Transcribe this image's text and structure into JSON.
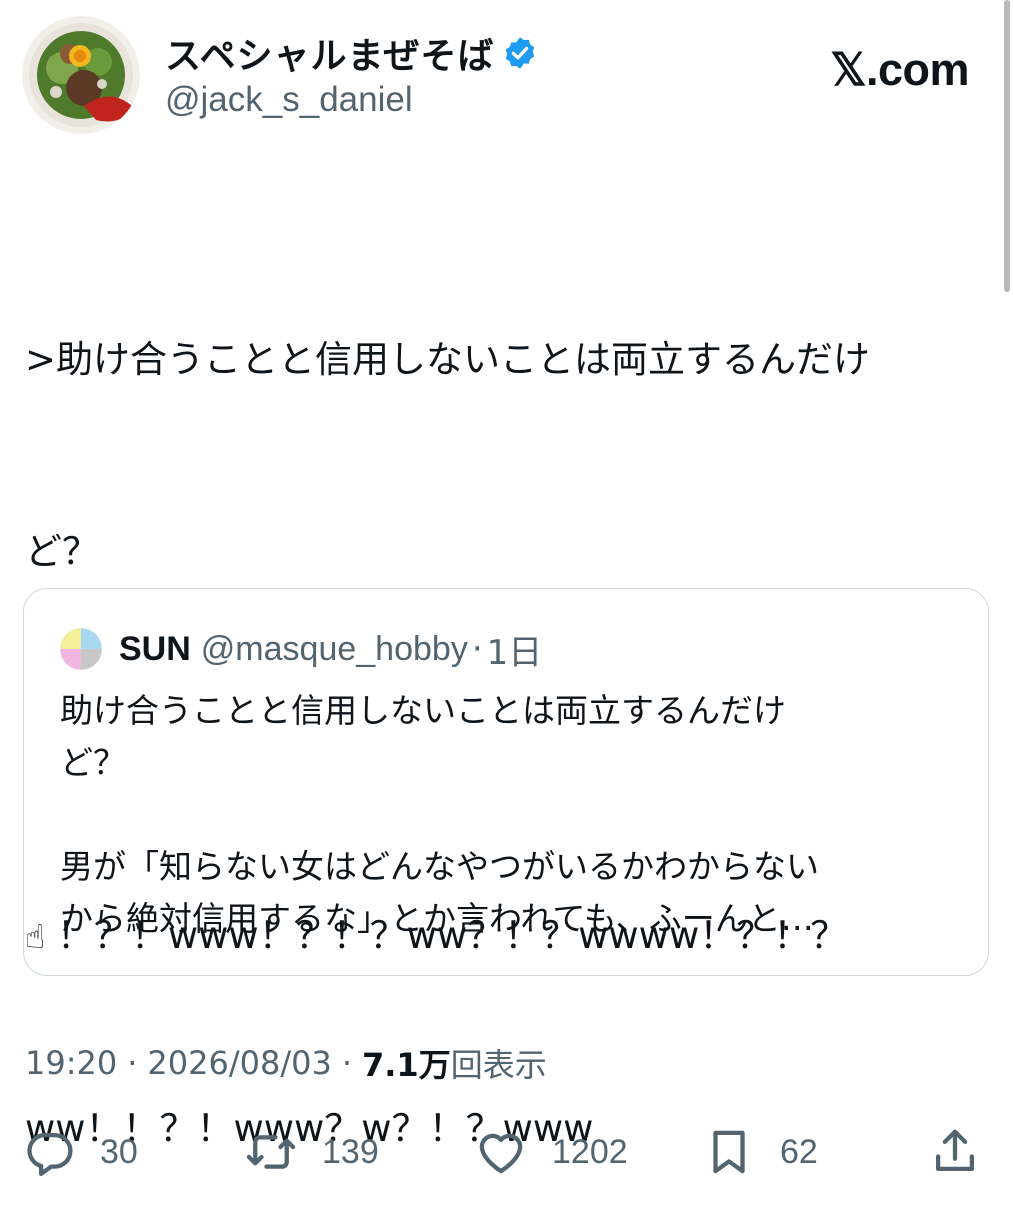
{
  "author": {
    "display_name": "スペシャルまぜそば",
    "handle": "@jack_s_daniel",
    "verified": true
  },
  "brand": "𝕏.com",
  "tweet": {
    "lines": [
      ">助け合うことと信用しないことは両立するんだけ",
      "ど？",
      "",
      "！？！www！？！？ww？！？wwww！？！？",
      "ww！！？！www？w？！？www"
    ],
    "emoji": "☝"
  },
  "quote": {
    "name": "SUN",
    "handle": "@masque_hobby",
    "separator": "·",
    "time": "1日",
    "lines": [
      "助け合うことと信用しないことは両立するんだけ",
      "ど？",
      "",
      "男が「知らない女はどんなやつがいるかわからない",
      "から絶対信用するな」とか言われても、ふーんと…"
    ]
  },
  "meta": {
    "time": "19:20",
    "separator": "·",
    "date": "2026/08/03",
    "views_count": "7.1万",
    "views_label": "回表示"
  },
  "actions": {
    "replies": "30",
    "retweets": "139",
    "likes": "1202",
    "bookmarks": "62"
  },
  "icons": [
    "verified-badge-icon",
    "reply-icon",
    "retweet-icon",
    "like-icon",
    "bookmark-icon",
    "share-icon"
  ],
  "colors": {
    "text": "#0f1419",
    "secondary": "#536471",
    "verified": "#1d9bf0",
    "border": "#cfd9de"
  }
}
